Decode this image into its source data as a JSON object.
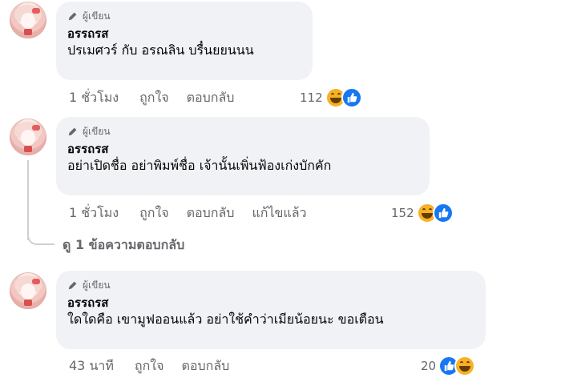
{
  "comments": [
    {
      "badge": "ผู้เขียน",
      "author": "อรรถรส",
      "text": "ปรเมศวร์ กับ อรณลิน บรื๋นยยนนน",
      "time": "1 ชั่วโมง",
      "like_label": "ถูกใจ",
      "reply_label": "ตอบกลับ",
      "edited_label": "",
      "reaction_count": "112",
      "reactions": [
        "haha-icon",
        "like-icon"
      ]
    },
    {
      "badge": "ผู้เขียน",
      "author": "อรรถรส",
      "text": "อย่าเปิดชื่อ อย่าพิมพ์ชื่อ เจ้านั้นเพิ่นฟ้องเก่งบักคัก",
      "time": "1 ชั่วโมง",
      "like_label": "ถูกใจ",
      "reply_label": "ตอบกลับ",
      "edited_label": "แก้ไขแล้ว",
      "reaction_count": "152",
      "reactions": [
        "haha-icon",
        "like-icon"
      ]
    },
    {
      "badge": "ผู้เขียน",
      "author": "อรรถรส",
      "text": "ใดใดคือ เขามูฟออนแล้ว อย่าใช้คำว่าเมียน้อยนะ ขอเตือน",
      "time": "43 นาที",
      "like_label": "ถูกใจ",
      "reply_label": "ตอบกลับ",
      "edited_label": "",
      "reaction_count": "20",
      "reactions": [
        "like-icon",
        "haha-icon"
      ]
    }
  ],
  "view_replies": "ดู 1 ข้อความตอบกลับ",
  "colors": {
    "bubble": "#f0f2f5",
    "muted": "#65676b",
    "like_blue": "#1877f2",
    "haha_yellow": "#f7b125"
  }
}
